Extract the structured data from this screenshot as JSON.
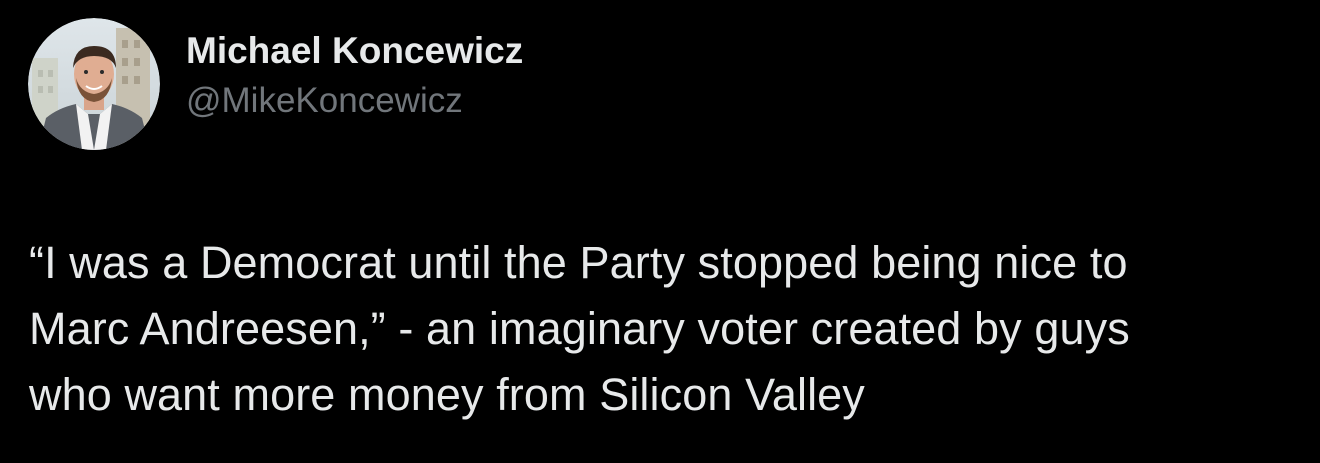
{
  "tweet": {
    "author": {
      "display_name": "Michael Koncewicz",
      "handle": "@MikeKoncewicz",
      "avatar_icon": "profile-photo-avatar"
    },
    "text": "“I was a Democrat until the Party stopped being nice to\nMarc Andreesen,” - an imaginary voter created by guys\nwho want more money from Silicon Valley"
  },
  "colors": {
    "background": "#000000",
    "primary_text": "#e7e9ea",
    "secondary_text": "#71767b"
  }
}
